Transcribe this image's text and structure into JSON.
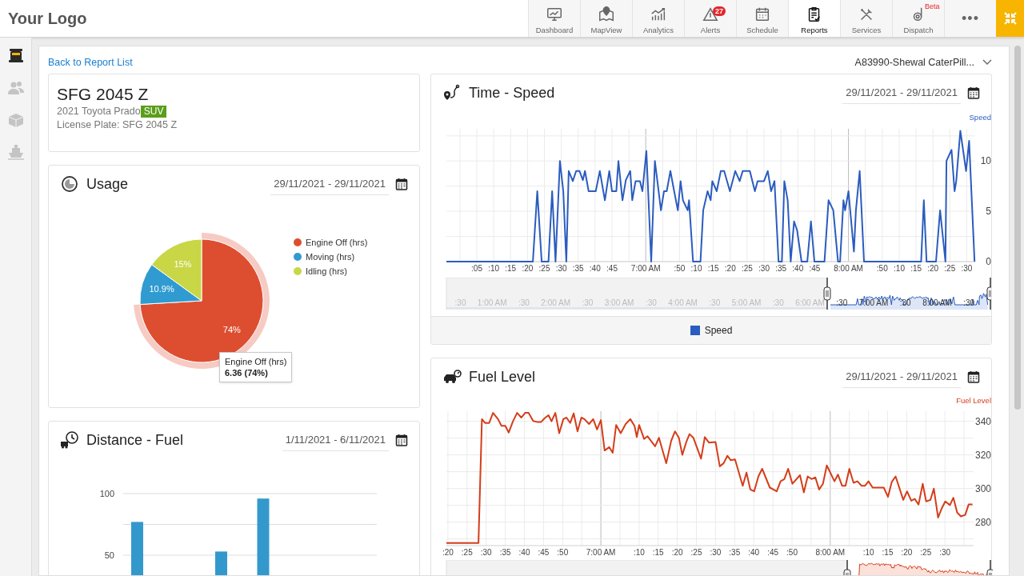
{
  "header": {
    "logo": "Your Logo",
    "nav": [
      {
        "label": "Dashboard",
        "selected": false
      },
      {
        "label": "MapView",
        "selected": false
      },
      {
        "label": "Analytics",
        "selected": false
      },
      {
        "label": "Alerts",
        "selected": false,
        "badge": "27"
      },
      {
        "label": "Schedule",
        "selected": false
      },
      {
        "label": "Reports",
        "selected": true
      },
      {
        "label": "Services",
        "selected": false
      },
      {
        "label": "Dispatch",
        "selected": false,
        "tag": "Beta"
      }
    ],
    "more": "•••"
  },
  "sidebar": {
    "items": [
      {
        "selected": true
      },
      {
        "selected": false
      },
      {
        "selected": false
      },
      {
        "selected": false
      }
    ]
  },
  "back_link": "Back to Report List",
  "vehicle_selector": {
    "value": "A83990-Shewal CaterPill..."
  },
  "vehicle": {
    "title": "SFG 2045 Z",
    "model": "2021 Toyota Prado",
    "type_tag": "SUV",
    "license": "License Plate: SFG 2045 Z"
  },
  "usage": {
    "title": "Usage",
    "date_range": "29/11/2021 - 29/11/2021",
    "chart_data": {
      "type": "pie",
      "categories": [
        "Engine Off (hrs)",
        "Moving (hrs)",
        "Idling (hrs)"
      ],
      "values": [
        74,
        10.9,
        15
      ],
      "value_labels": [
        "74%",
        "10.9%",
        "15%"
      ],
      "legend": "right"
    },
    "slices": [
      {
        "color": "#dd4e31",
        "highlighted": true
      },
      {
        "color": "#2f9bd0",
        "highlighted": false
      },
      {
        "color": "#c9d646",
        "highlighted": false
      }
    ],
    "tooltip": {
      "title": "Engine Off (hrs)",
      "value": "6.36 (74%)"
    }
  },
  "distance_fuel": {
    "title": "Distance - Fuel",
    "date_range": "1/11/2021 - 6/11/2021",
    "chart_data": {
      "type": "bar",
      "values": [
        77,
        null,
        53,
        96,
        null,
        null
      ],
      "ylim": [
        0,
        100
      ],
      "yticks": [
        50,
        100
      ],
      "grid": true
    }
  },
  "time_speed": {
    "title": "Time - Speed",
    "date_range": "29/11/2021 - 29/11/2021",
    "chart_data": {
      "type": "line",
      "x": [
        361,
        386.6,
        387.9,
        389.2,
        391.2,
        392.3,
        393.3,
        394.6,
        395.6,
        396.5,
        397.2,
        398.4,
        399.4,
        400.4,
        401.4,
        402,
        403.1,
        405.2,
        406.4,
        407.9,
        409.2,
        410,
        411.3,
        411.9,
        413.1,
        414.1,
        415.4,
        416,
        417,
        418.3,
        419,
        420.2,
        421.6,
        422.7,
        424.5,
        425.4,
        426.2,
        427.3,
        428.4,
        429.5,
        430.3,
        431,
        432.4,
        432.8,
        434,
        436.2,
        437,
        438.3,
        439.2,
        439.7,
        441,
        442.2,
        443.2,
        444.9,
        446.5,
        447.8,
        448.7,
        450.8,
        452.3,
        453.1,
        455,
        456.1,
        457.1,
        458.1,
        459.3,
        460.3,
        461,
        462,
        462.9,
        463.9,
        464.8,
        466.1,
        467.8,
        468.9,
        469.9,
        472.9,
        474.1,
        475.5,
        476.9,
        477.5,
        478.5,
        479,
        480,
        481.6,
        482.2,
        483.3,
        484.6,
        501.5,
        502.3,
        503.1,
        505.9,
        507.1,
        508.7,
        509,
        510.5,
        511.4,
        511.9,
        513.1,
        514.8,
        515.7,
        517.3
      ],
      "series": [
        {
          "name": "Speed",
          "color": "#2b5cbf",
          "values": [
            0,
            0,
            7,
            0,
            0,
            7,
            0,
            10,
            7,
            0,
            9,
            8,
            9,
            9,
            8.1,
            9,
            7,
            7,
            9,
            6.1,
            9,
            7,
            7,
            10,
            6.1,
            8.1,
            9,
            6.1,
            8,
            8,
            7,
            11,
            0,
            10,
            5.1,
            7,
            7,
            9,
            7,
            5.1,
            8,
            6.1,
            5.1,
            6.1,
            0,
            0,
            5.1,
            7,
            6.1,
            8,
            7,
            9,
            9,
            7,
            9,
            8,
            9,
            9,
            7,
            8,
            8,
            9,
            7,
            8,
            0,
            0,
            8,
            6.1,
            0,
            4,
            3.1,
            0,
            0,
            4,
            0,
            0,
            6.1,
            5.1,
            0,
            0,
            6.1,
            5.1,
            7,
            1,
            5.1,
            9,
            0,
            0,
            6.1,
            0,
            0,
            5.1,
            0,
            10,
            11.1,
            7,
            8,
            13,
            9,
            12,
            0
          ]
        }
      ],
      "xlim": [
        361,
        517.5
      ],
      "ylim": [
        0,
        13.2
      ],
      "grid": true,
      "xticks": [
        {
          "value": 420,
          "label": "7:00 AM"
        },
        {
          "value": 480,
          "label": "8:00 AM"
        }
      ],
      "yticks": [
        0,
        5,
        10
      ]
    },
    "minor_tick_labels": [
      ":05",
      ":10",
      ":15",
      ":20",
      ":25",
      ":30",
      ":35",
      ":40",
      ":45",
      ":50",
      ":10",
      ":15",
      ":20",
      ":25",
      ":30",
      ":35",
      ":40",
      ":45",
      ":50",
      ":10",
      ":15",
      ":20",
      ":25",
      ":30"
    ],
    "navigator": {
      "labels": [
        ":30",
        "1:00 AM",
        ":30",
        "2:00 AM",
        ":30",
        "3:00 AM",
        ":30",
        "4:00 AM",
        ":30",
        "5:00 AM",
        ":30",
        "6:00 AM",
        ":30",
        "7:00 AM",
        ":30",
        "8:00 AM",
        ":30"
      ]
    },
    "legend": {
      "label": "Speed",
      "color": "#2b5cbf"
    }
  },
  "fuel_level": {
    "title": "Fuel Level",
    "date_range": "29/11/2021 - 29/11/2021",
    "chart_data": {
      "type": "line",
      "x": [
        379.6,
        388,
        388.9,
        389.7,
        390.8,
        391.8,
        393.1,
        394,
        395,
        395.9,
        397,
        398.1,
        399.2,
        400.2,
        401.1,
        402.3,
        403.3,
        404.4,
        405.3,
        406.3,
        407.1,
        408.1,
        409.1,
        410.2,
        411,
        412,
        412.9,
        413.9,
        414.9,
        415.7,
        416.9,
        418,
        419,
        420,
        421,
        422.2,
        423.1,
        424,
        425.2,
        426.5,
        427.7,
        428.8,
        429.4,
        430,
        431.3,
        432.2,
        434.2,
        435.2,
        437.1,
        438.4,
        439.4,
        440.4,
        441.3,
        442.4,
        443.2,
        444.2,
        446.2,
        447.2,
        448.3,
        450,
        451.1,
        452.1,
        453.1,
        454,
        455.1,
        457.1,
        458.1,
        459.1,
        460.1,
        461.2,
        462.2,
        464.2,
        466,
        467,
        468,
        469,
        470.1,
        472.1,
        473.1,
        474.1,
        475.1,
        476.1,
        477.1,
        478.1,
        479.1,
        481.1,
        482,
        483.1,
        484,
        485,
        486.1,
        487.1,
        488.2,
        489.1,
        490,
        491.1,
        494,
        495.1,
        496.1,
        497.1,
        499.1,
        500.1,
        501.2,
        502.1,
        503.1,
        504.2,
        505.1,
        506.2,
        507.1,
        508.2,
        509.2,
        510.1,
        511.3,
        512.2,
        513.2,
        514.2,
        515.3,
        516.2,
        517.2
      ],
      "series": [
        {
          "name": "Fuel Level",
          "color": "#d43d1a",
          "values": [
            267.5,
            267.5,
            341.3,
            339,
            339,
            345,
            341.3,
            337.3,
            337.3,
            333.3,
            340,
            345,
            342.2,
            345,
            345,
            340.2,
            339.6,
            339.6,
            341.8,
            343.6,
            340,
            345,
            332.9,
            341.3,
            342.2,
            339,
            344.7,
            334,
            342.2,
            341.3,
            338.4,
            341.3,
            335.1,
            340.7,
            322.6,
            324.6,
            321.3,
            337.8,
            332.9,
            338.4,
            341.3,
            337.3,
            330.6,
            337.8,
            329.5,
            331.1,
            325.1,
            330.2,
            315,
            328.4,
            334,
            330.2,
            320,
            328,
            332.4,
            330.2,
            317.7,
            330.6,
            327.3,
            327.7,
            313.2,
            315,
            319.5,
            316.8,
            317.3,
            301.6,
            309.5,
            299.4,
            298.3,
            307.2,
            311.7,
            300.5,
            298.3,
            304.3,
            305.6,
            311.7,
            302.8,
            307.9,
            297.6,
            307.2,
            305.6,
            306.6,
            299.4,
            302.8,
            313.7,
            304.3,
            308.3,
            301.6,
            301.6,
            311.7,
            303.4,
            304.3,
            301.6,
            301.6,
            304.3,
            300.5,
            300.5,
            295,
            303.9,
            307.2,
            293.2,
            298.3,
            292.7,
            293.8,
            290.5,
            302.8,
            292.3,
            293.2,
            299.9,
            282.7,
            288.3,
            292.3,
            290.1,
            294.5,
            285.6,
            283.4,
            284.3,
            290.5,
            290.5
          ]
        }
      ],
      "xlim": [
        379.6,
        517.5
      ],
      "ylim": [
        266,
        346
      ],
      "grid": true,
      "xticks": [
        {
          "value": 420,
          "label": "7:00 AM"
        },
        {
          "value": 480,
          "label": "8:00 AM"
        }
      ],
      "yticks": [
        280,
        300,
        320,
        340
      ]
    },
    "minor_tick_labels": [
      ":20",
      ":25",
      ":30",
      ":35",
      ":40",
      ":45",
      ":50",
      ":10",
      ":15",
      ":20",
      ":25",
      ":30",
      ":35",
      ":40",
      ":45",
      ":50",
      ":10",
      ":15",
      ":20",
      ":25",
      ":30"
    ]
  }
}
